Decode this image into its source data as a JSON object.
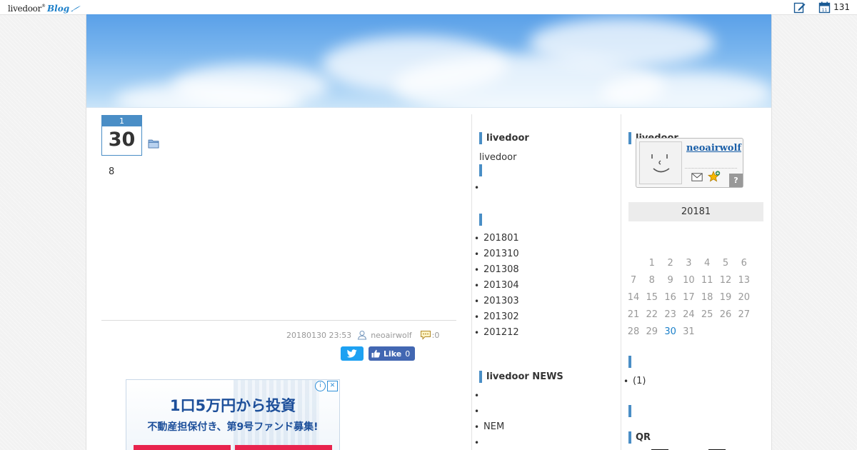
{
  "topbar": {
    "logo_main": "livedoor",
    "logo_sup": "®",
    "logo_blog": "Blog",
    "count": "131"
  },
  "article": {
    "month": "1",
    "day": "30",
    "body": "8",
    "meta_date": "20180130 23:53",
    "author": "neoairwolf",
    "comments": ":0",
    "fb_like": "Like",
    "fb_count": "0"
  },
  "ad": {
    "headline": "1口5万円から投資",
    "sub": "不動産担保付き、第9号ファンド募集!",
    "badge_info": "i",
    "badge_close": "✕"
  },
  "sidebar1": {
    "head1": "livedoor",
    "text1": "livedoor",
    "head2": "",
    "list1": [
      ""
    ],
    "head3": "",
    "archives": [
      "201801",
      "201310",
      "201308",
      "201304",
      "201303",
      "201302",
      "201212"
    ],
    "head_news": "livedoor NEWS",
    "news": [
      "",
      "",
      "NEM",
      "",
      ""
    ]
  },
  "sidebar2": {
    "head1": "livedoor",
    "profile_name": "neoairwolf",
    "help": "?",
    "calendar_title": "20181",
    "calendar_days": [
      "1",
      "2",
      "3",
      "4",
      "5",
      "6",
      "7",
      "8",
      "9",
      "10",
      "11",
      "12",
      "13",
      "14",
      "15",
      "16",
      "17",
      "18",
      "19",
      "20",
      "21",
      "22",
      "23",
      "24",
      "25",
      "26",
      "27",
      "28",
      "29",
      "30",
      "31"
    ],
    "calendar_today": "30",
    "head2": "",
    "categories": [
      "(1)"
    ],
    "head3": "",
    "head_qr": "QR"
  },
  "colors": {
    "accent": "#4a8ec6",
    "link": "#1a5fa8",
    "twitter": "#1da1f2",
    "facebook": "#4267b2",
    "ad_button": "#e8234d"
  }
}
